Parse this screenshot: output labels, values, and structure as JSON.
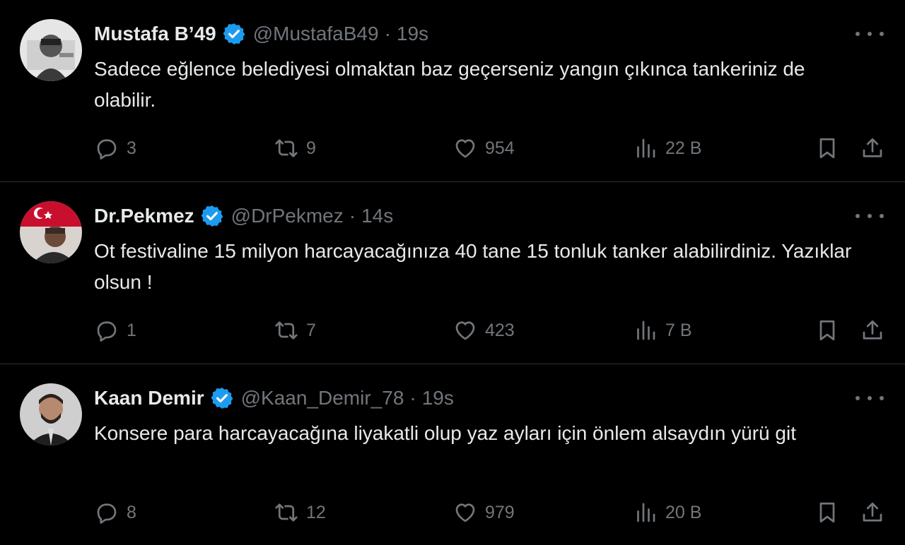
{
  "tweets": [
    {
      "name": "Mustafa B’49",
      "handle": "@MustafaB49",
      "separator": "·",
      "time": "19s",
      "text": "Sadece eğlence belediyesi olmaktan baz geçerseniz yangın çıkınca tankeriniz de olabilir.",
      "replies": "3",
      "retweets": "9",
      "likes": "954",
      "views": "22 B"
    },
    {
      "name": "Dr.Pekmez",
      "handle": "@DrPekmez",
      "separator": "·",
      "time": "14s",
      "text": "Ot festivaline 15 milyon harcayacağınıza 40 tane 15 tonluk tanker alabilirdiniz. Yazıklar olsun !",
      "replies": "1",
      "retweets": "7",
      "likes": "423",
      "views": "7 B"
    },
    {
      "name": "Kaan Demir",
      "handle": "@Kaan_Demir_78",
      "separator": "·",
      "time": "19s",
      "text": "Konsere para harcayacağına liyakatli olup yaz ayları için önlem alsaydın yürü git",
      "replies": "8",
      "retweets": "12",
      "likes": "979",
      "views": "20 B"
    }
  ],
  "icons": {
    "verified": "verified-badge-icon",
    "more": "more-options-icon",
    "reply": "reply-icon",
    "retweet": "retweet-icon",
    "like": "heart-icon",
    "views": "views-chart-icon",
    "bookmark": "bookmark-icon",
    "share": "share-icon"
  },
  "colors": {
    "background": "#000000",
    "text": "#e7e9ea",
    "muted": "#71767b",
    "verified": "#1d9bf0",
    "divider": "#2f3336"
  }
}
